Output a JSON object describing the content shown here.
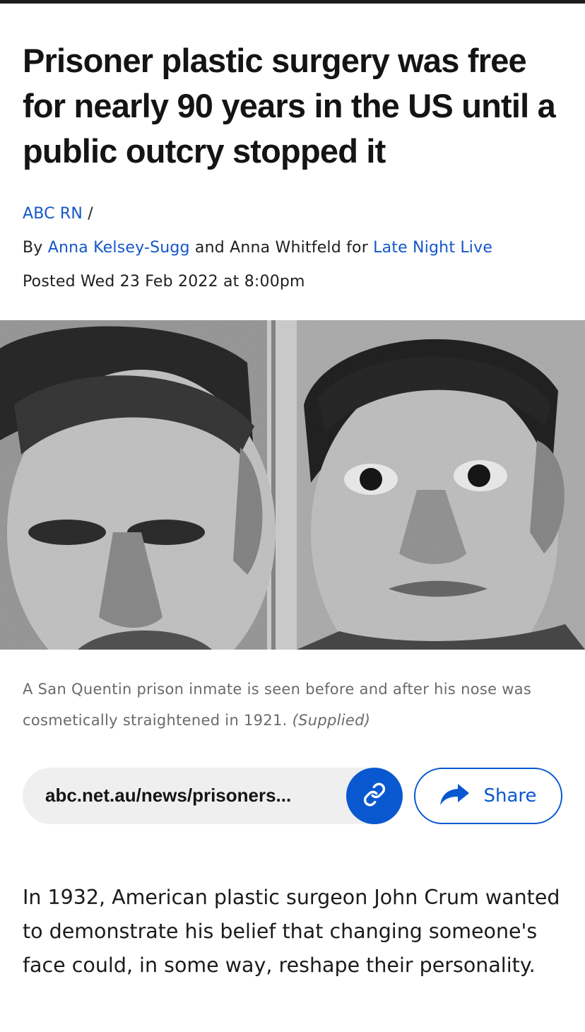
{
  "article": {
    "headline": "Prisoner plastic surgery was free for nearly 90 years in the US until a public outcry stopped it",
    "section": {
      "label": "ABC RN",
      "separator": "/"
    },
    "byline": {
      "prefix": "By",
      "author1": "Anna Kelsey-Sugg",
      "joiner": "and Anna Whitfeld for",
      "program": "Late Night Live"
    },
    "posted": "Posted Wed 23 Feb 2022 at 8:00pm",
    "image_caption": "A San Quentin prison inmate is seen before and after his nose was cosmetically straightened in 1921.",
    "image_credit": "(Supplied)",
    "body_paragraph": "In 1932, American plastic surgeon John Crum wanted to demonstrate his belief that changing someone's face could, in some way, reshape their personality."
  },
  "share": {
    "url": "abc.net.au/news/prisoners...",
    "copy_icon": "link-icon",
    "share_icon": "share-arrow-icon",
    "share_label": "Share"
  },
  "colors": {
    "link": "#1457c9",
    "accent": "#0a58d0",
    "caption": "#6a6a6a",
    "pill": "#efefef"
  }
}
